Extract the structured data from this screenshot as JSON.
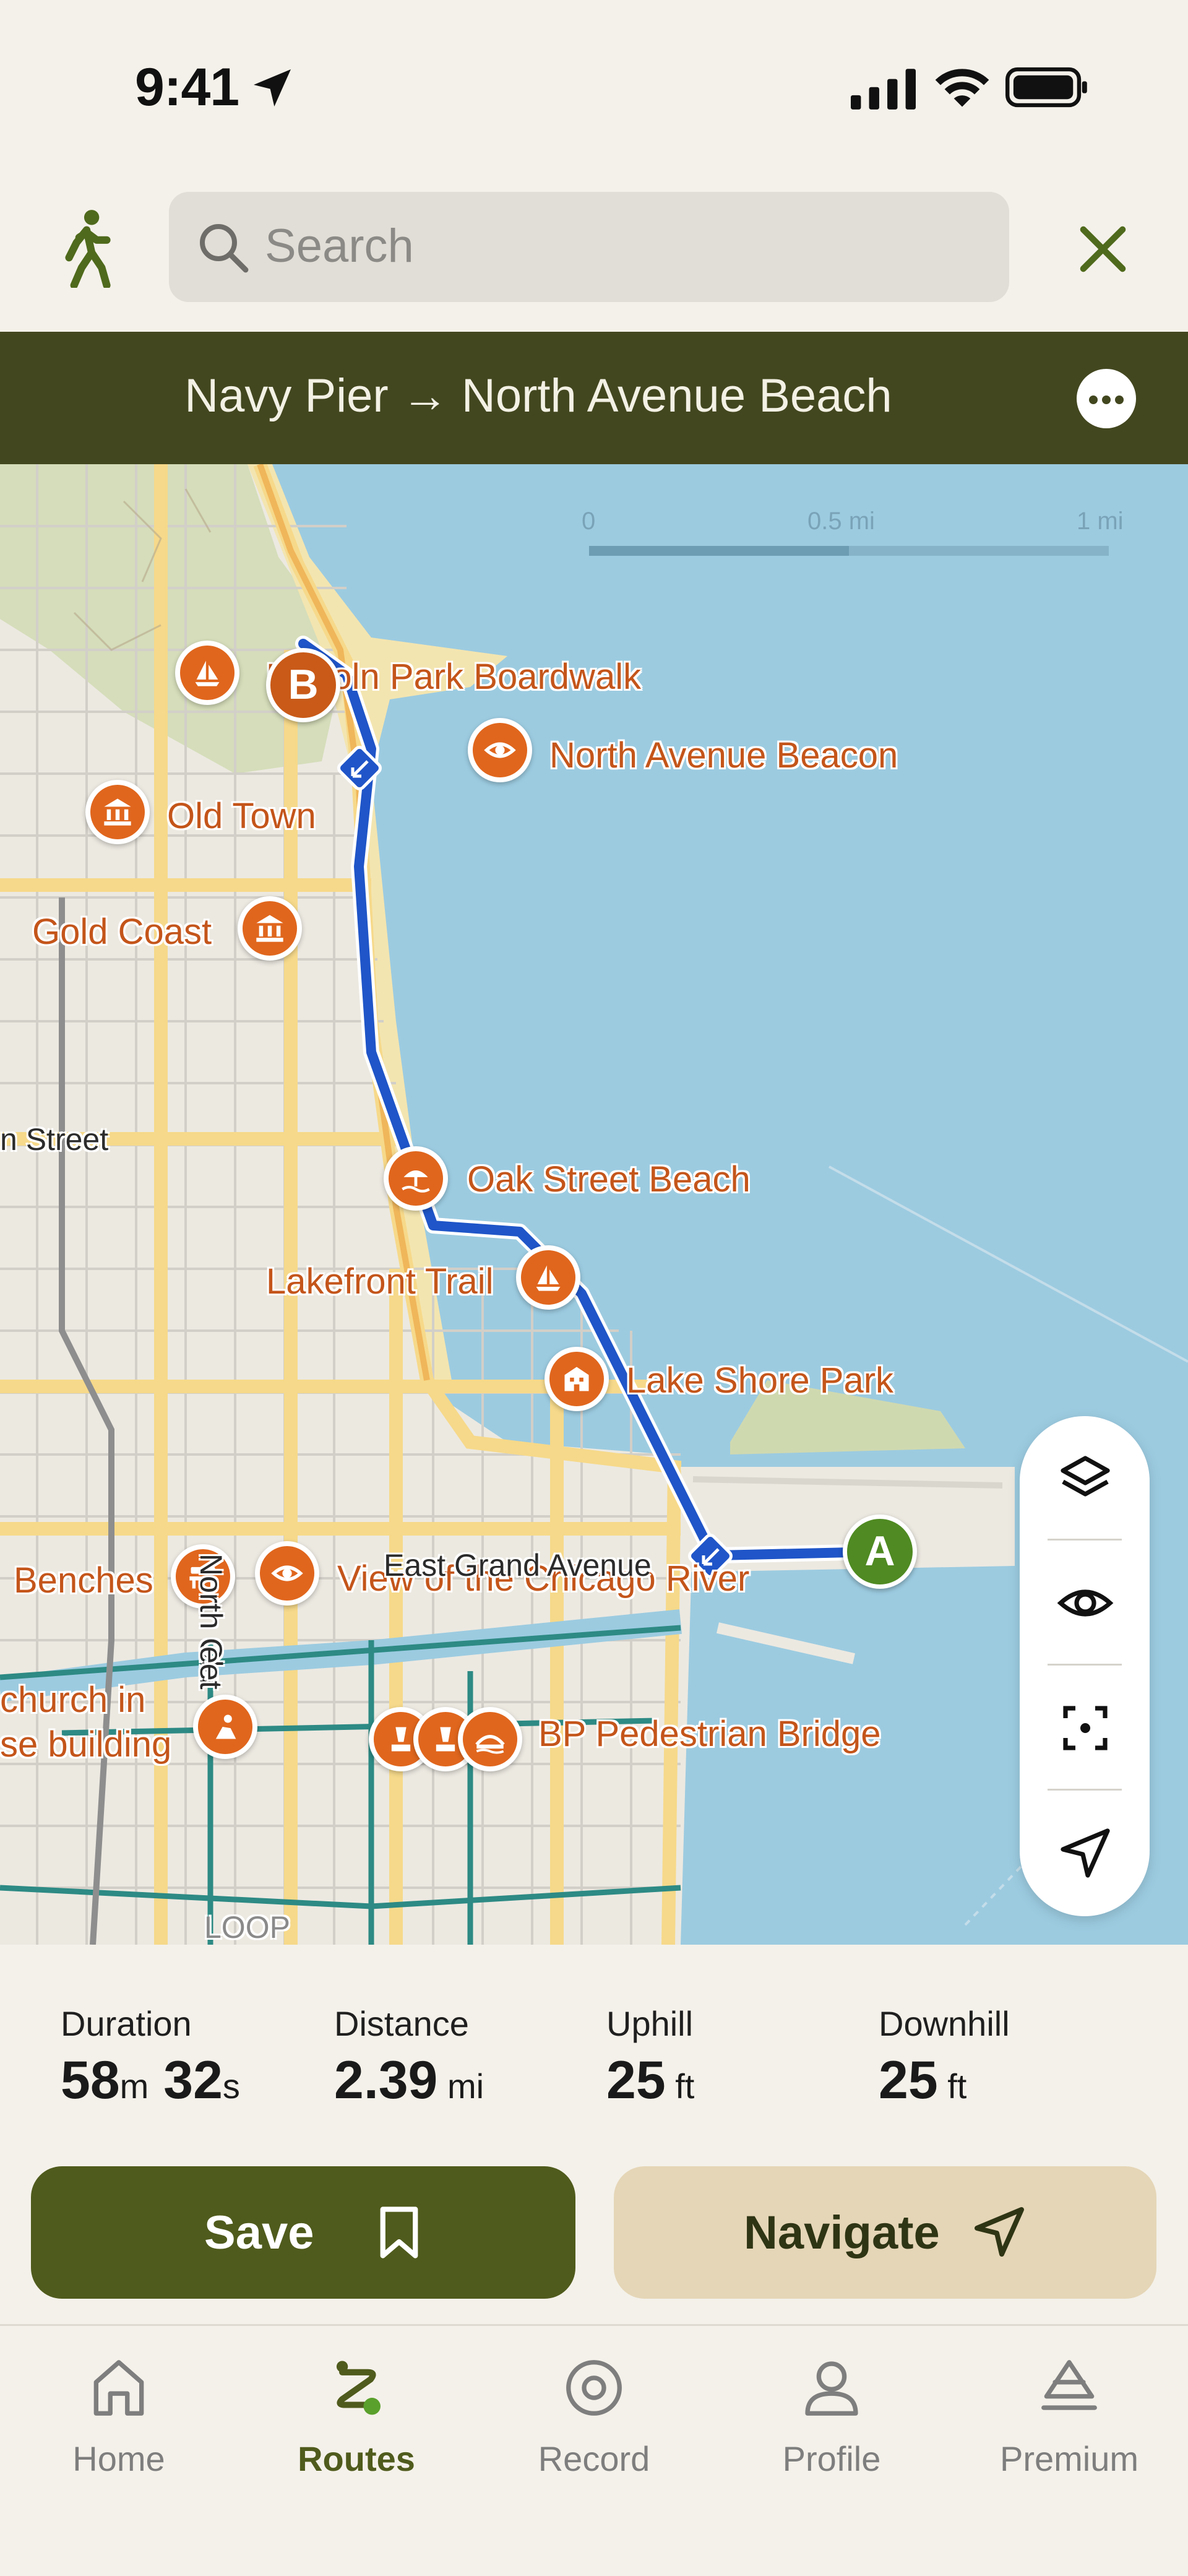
{
  "status_bar": {
    "time": "9:41"
  },
  "search": {
    "placeholder": "Search"
  },
  "route": {
    "title": "Navy Pier → North Avenue Beach"
  },
  "map": {
    "scale": {
      "labels": [
        "0",
        "0.5 mi",
        "1 mi"
      ]
    },
    "pois": [
      {
        "label": "Lincoln Park Boardwalk",
        "icon": "sailboat-icon"
      },
      {
        "label": "North Avenue Beacon",
        "icon": "eye-icon"
      },
      {
        "label": "Old Town",
        "icon": "museum-icon"
      },
      {
        "label": "Gold Coast",
        "icon": "museum-icon"
      },
      {
        "label": "Oak Street Beach",
        "icon": "beach-icon"
      },
      {
        "label": "Lakefront Trail",
        "icon": "sailboat-icon"
      },
      {
        "label": "Lake Shore Park",
        "icon": "building-icon"
      },
      {
        "label": "Benches",
        "icon": "bench-icon"
      },
      {
        "label": "View of the Chicago River",
        "icon": "eye-icon"
      },
      {
        "label": "church in",
        "icon": "church-icon"
      },
      {
        "label": "se building",
        "icon": ""
      },
      {
        "label": "BP Pedestrian Bridge",
        "icon": "bridge-icon"
      }
    ],
    "streets": [
      "n Street",
      "East Grand Avenue",
      "North Cla",
      "eet",
      "LOOP"
    ],
    "markers": {
      "start": "A",
      "end": "B"
    },
    "colors": {
      "water": "#9ccbe0",
      "route": "#1f55c8",
      "poi": "#e0661d",
      "start": "#4f8a22",
      "end": "#c95a18"
    }
  },
  "stats": [
    {
      "label": "Duration",
      "value": "58",
      "unit": "m",
      "value2": "32",
      "unit2": "s"
    },
    {
      "label": "Distance",
      "value": "2.39",
      "unit": " mi"
    },
    {
      "label": "Uphill",
      "value": "25",
      "unit": " ft"
    },
    {
      "label": "Downhill",
      "value": "25",
      "unit": " ft"
    }
  ],
  "actions": {
    "save": "Save",
    "navigate": "Navigate"
  },
  "tabs": [
    {
      "label": "Home",
      "icon": "home-icon",
      "active": false
    },
    {
      "label": "Routes",
      "icon": "routes-icon",
      "active": true
    },
    {
      "label": "Record",
      "icon": "record-icon",
      "active": false
    },
    {
      "label": "Profile",
      "icon": "profile-icon",
      "active": false
    },
    {
      "label": "Premium",
      "icon": "premium-icon",
      "active": false
    }
  ]
}
